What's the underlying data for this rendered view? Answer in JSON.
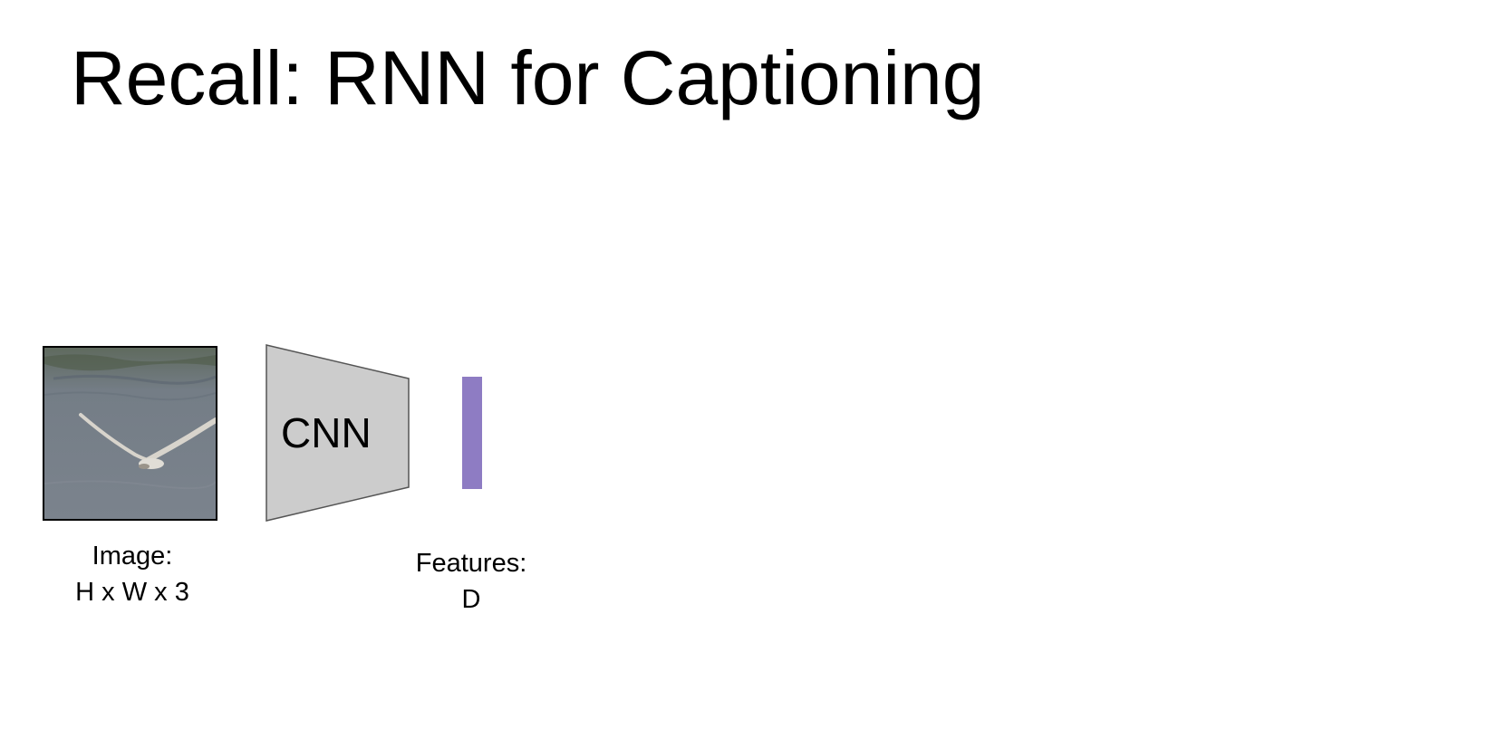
{
  "title": "Recall: RNN for Captioning",
  "diagram": {
    "image": {
      "caption_line1": "Image:",
      "caption_line2": "H x W x 3"
    },
    "cnn": {
      "label": "CNN",
      "fill": "#cccccc",
      "stroke": "#555555"
    },
    "features": {
      "caption_line1": "Features:",
      "caption_line2": "D",
      "bar_color": "#8e7cc3"
    }
  }
}
